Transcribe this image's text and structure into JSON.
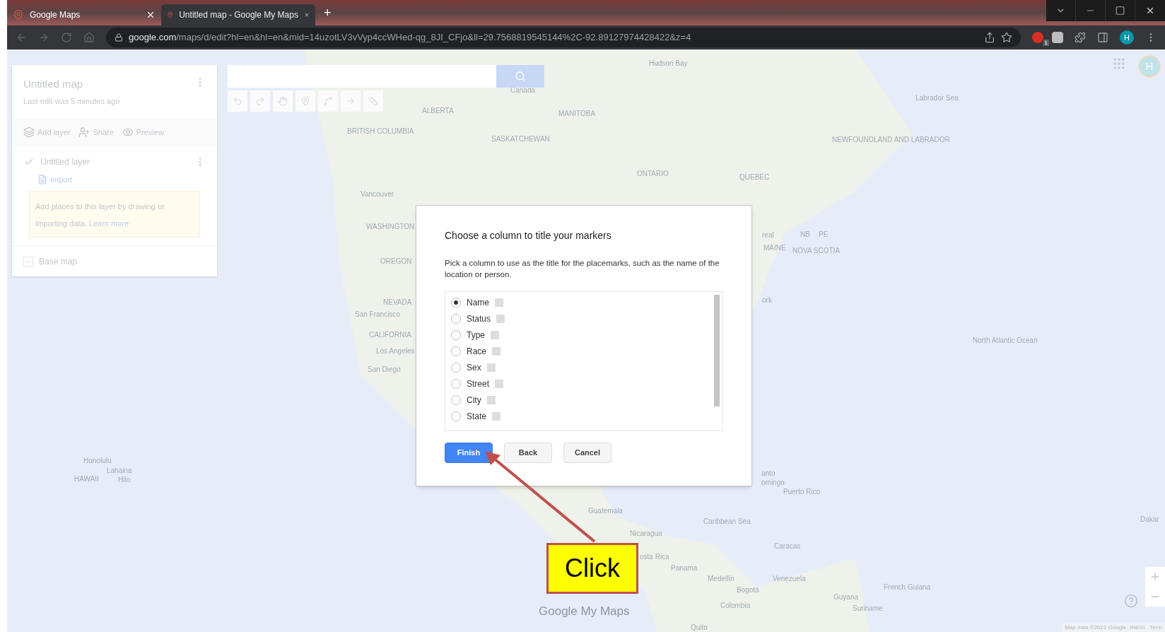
{
  "browser": {
    "tabs": [
      {
        "title": "Google Maps",
        "selected": false
      },
      {
        "title": "Untitled map - Google My Maps",
        "selected": true
      }
    ],
    "new_tab": "+",
    "url_host": "google.com",
    "url_path": "/maps/d/edit?hl=en&hl=en&mid=14uzotLV3vVyp4ccWHed-qg_8JI_CFjo&ll=29.7568819545144%2C-92.89127974428422&z=4",
    "extension_badge": "1",
    "profile_initial": "H"
  },
  "sidebar": {
    "title": "Untitled map",
    "subtitle": "Last edit was 5 minutes ago",
    "actions": [
      "Add layer",
      "Share",
      "Preview"
    ],
    "layer": {
      "name": "Untitled layer",
      "checked": true,
      "import": "Import",
      "hint": "Add places to this layer by drawing or importing data.",
      "hint_link": "Learn more"
    },
    "base_map": {
      "label": "Base map",
      "checked": false
    }
  },
  "account_initial": "H",
  "map_labels": [
    "Hudson Bay",
    "Canada",
    "Labrador Sea",
    "ALBERTA",
    "MANITOBA",
    "BRITISH COLUMBIA",
    "SASKATCHEWAN",
    "NEWFOUNDLAND AND LABRADOR",
    "ONTARIO",
    "QUEBEC",
    "Vancouver",
    "WASHINGTON",
    "OREGON",
    "NEVADA",
    "San Francisco",
    "CALIFORNIA",
    "Los Angeles",
    "San Diego",
    "Honolulu",
    "Lahaina",
    "HAWAII",
    "Hilo",
    "North Atlantic Ocean",
    "Puerto Rico",
    "Guatemala",
    "Nicaragua",
    "osta Rica",
    "Panama",
    "Caribbean Sea",
    "Caracas",
    "Venezuela",
    "Medellín",
    "Bogotá",
    "Colombia",
    "Guyana",
    "French Guiana",
    "Suriname",
    "Quito",
    "Dakar",
    "real",
    "ork",
    "anto",
    "omingo",
    "NOVA SCOTIA",
    "MAINE",
    "NB",
    "PE"
  ],
  "map_logo": "Google My Maps",
  "attribution": "Map data ©2022 Google, INEGI   Term",
  "dialog": {
    "title": "Choose a column to title your markers",
    "description": "Pick a column to use as the title for the placemarks, such as the name of the location or person.",
    "options": [
      {
        "label": "Name",
        "selected": true
      },
      {
        "label": "Status",
        "selected": false
      },
      {
        "label": "Type",
        "selected": false
      },
      {
        "label": "Race",
        "selected": false
      },
      {
        "label": "Sex",
        "selected": false
      },
      {
        "label": "Street",
        "selected": false
      },
      {
        "label": "City",
        "selected": false
      },
      {
        "label": "State",
        "selected": false
      }
    ],
    "buttons": [
      {
        "label": "Finish",
        "kind": "primary"
      },
      {
        "label": "Back",
        "kind": "secondary"
      },
      {
        "label": "Cancel",
        "kind": "secondary"
      }
    ]
  },
  "annotation": {
    "label": "Click"
  }
}
